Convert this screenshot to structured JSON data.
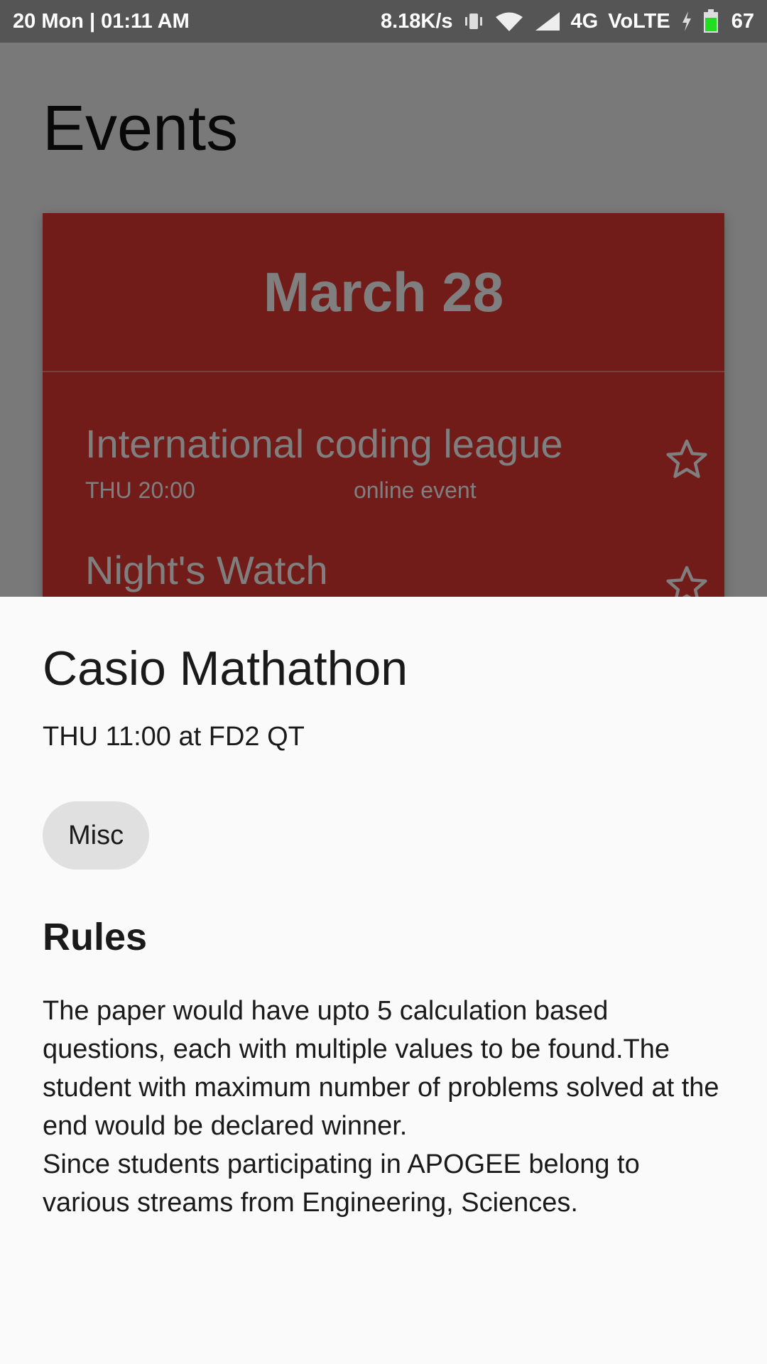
{
  "status_bar": {
    "date_time": "20 Mon  |  01:11 AM",
    "speed": "8.18K/s",
    "network": "4G",
    "volte": "VoLTE",
    "battery_percent": "67",
    "icons": [
      "vibrate-icon",
      "wifi-icon",
      "signal-icon",
      "charging-icon",
      "battery-icon"
    ],
    "battery_color": "#22dd22"
  },
  "page": {
    "title": "Events"
  },
  "card": {
    "color": "#e53935",
    "date": "March 28",
    "events": [
      {
        "title": "International coding league",
        "day": "THU 20:00",
        "venue": "online event"
      },
      {
        "title": "Night's Watch",
        "day": "",
        "venue": ""
      }
    ]
  },
  "sheet": {
    "title": "Casio Mathathon",
    "subtitle": "THU 11:00 at FD2 QT",
    "category_chip": "Misc",
    "rules_heading": "Rules",
    "rules_paragraphs": [
      "The paper would have upto 5 calculation based questions, each with multiple values to be found.The student with maximum number of problems solved at the end would be declared winner.",
      "Since students participating in APOGEE belong to various streams from Engineering, Sciences."
    ]
  }
}
